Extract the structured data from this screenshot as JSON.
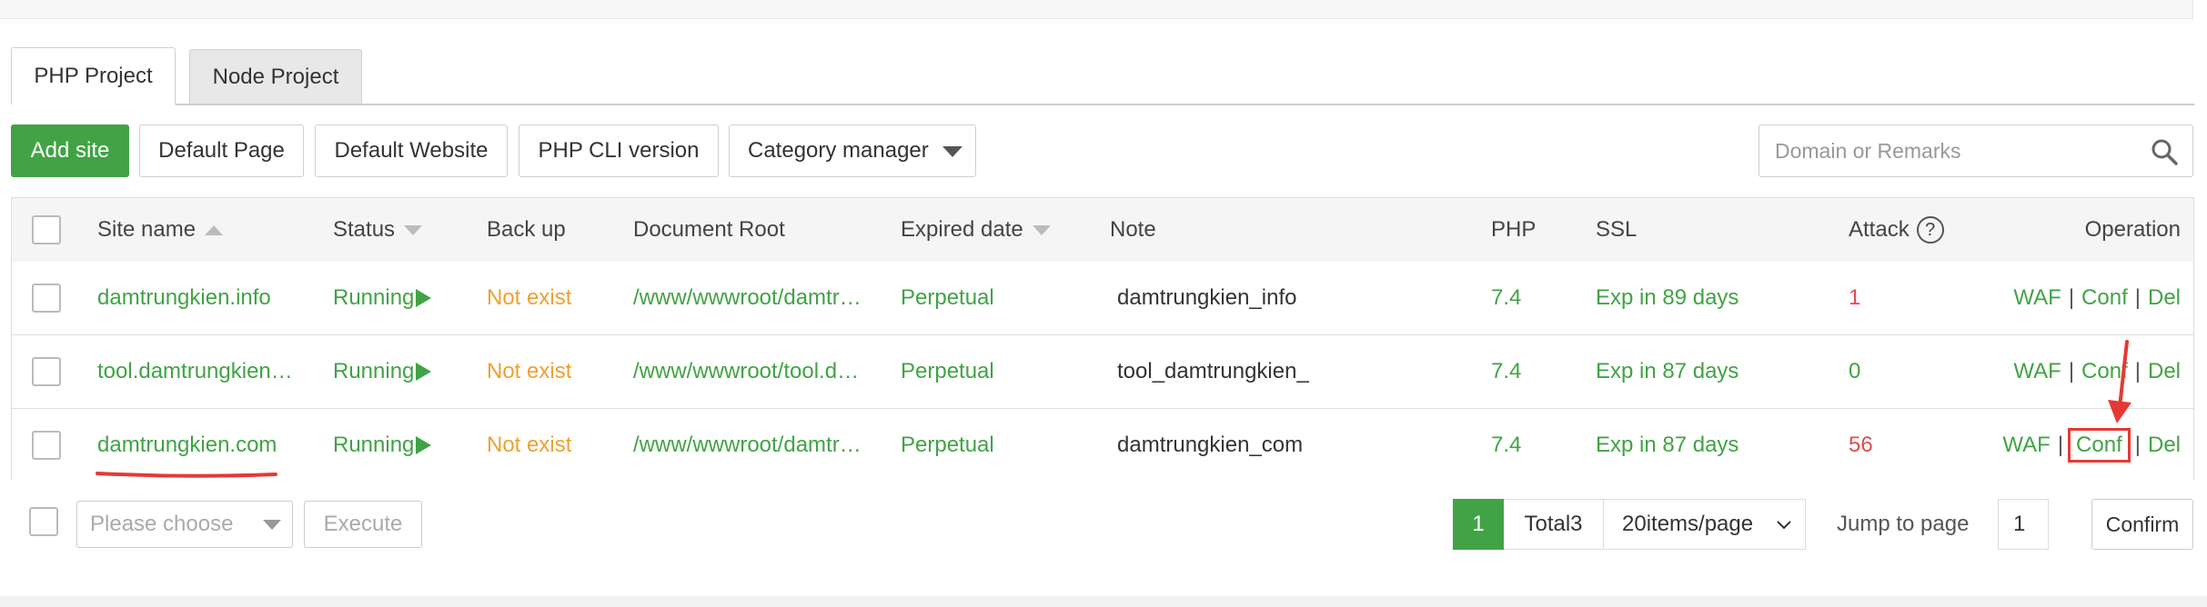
{
  "tabs": [
    {
      "label": "PHP Project"
    },
    {
      "label": "Node Project"
    }
  ],
  "toolbar": {
    "add_site": "Add site",
    "default_page": "Default Page",
    "default_website": "Default Website",
    "php_cli": "PHP CLI version",
    "category_manager": "Category manager"
  },
  "search": {
    "placeholder": "Domain or Remarks"
  },
  "table": {
    "headers": {
      "site_name": "Site name",
      "status": "Status",
      "backup": "Back up",
      "docroot": "Document Root",
      "expired": "Expired date",
      "note": "Note",
      "php": "PHP",
      "ssl": "SSL",
      "attack": "Attack",
      "attack_help": "?",
      "operation": "Operation"
    },
    "rows": [
      {
        "site": "damtrungkien.info",
        "status": "Running",
        "backup": "Not exist",
        "docroot": "/www/wwwroot/damtr…",
        "expired": "Perpetual",
        "note": "damtrungkien_info",
        "php": "7.4",
        "ssl": "Exp in 89 days",
        "attack": "1"
      },
      {
        "site": "tool.damtrungkien…",
        "status": "Running",
        "backup": "Not exist",
        "docroot": "/www/wwwroot/tool.d…",
        "expired": "Perpetual",
        "note": "tool_damtrungkien_",
        "php": "7.4",
        "ssl": "Exp in 87 days",
        "attack": "0"
      },
      {
        "site": "damtrungkien.com",
        "status": "Running",
        "backup": "Not exist",
        "docroot": "/www/wwwroot/damtr…",
        "expired": "Perpetual",
        "note": "damtrungkien_com",
        "php": "7.4",
        "ssl": "Exp in 87 days",
        "attack": "56"
      }
    ],
    "operations": {
      "waf": "WAF",
      "conf": "Conf",
      "del": "Del",
      "sep": "|"
    }
  },
  "footer": {
    "batch_placeholder": "Please choose",
    "execute": "Execute",
    "current_page": "1",
    "total": "Total3",
    "page_size": "20items/page",
    "jump_label": "Jump to page",
    "jump_value": "1",
    "confirm": "Confirm"
  },
  "colors": {
    "accent": "#41a345",
    "warning": "#f0a030",
    "danger": "#e24b4b",
    "annotation": "#e53935"
  }
}
